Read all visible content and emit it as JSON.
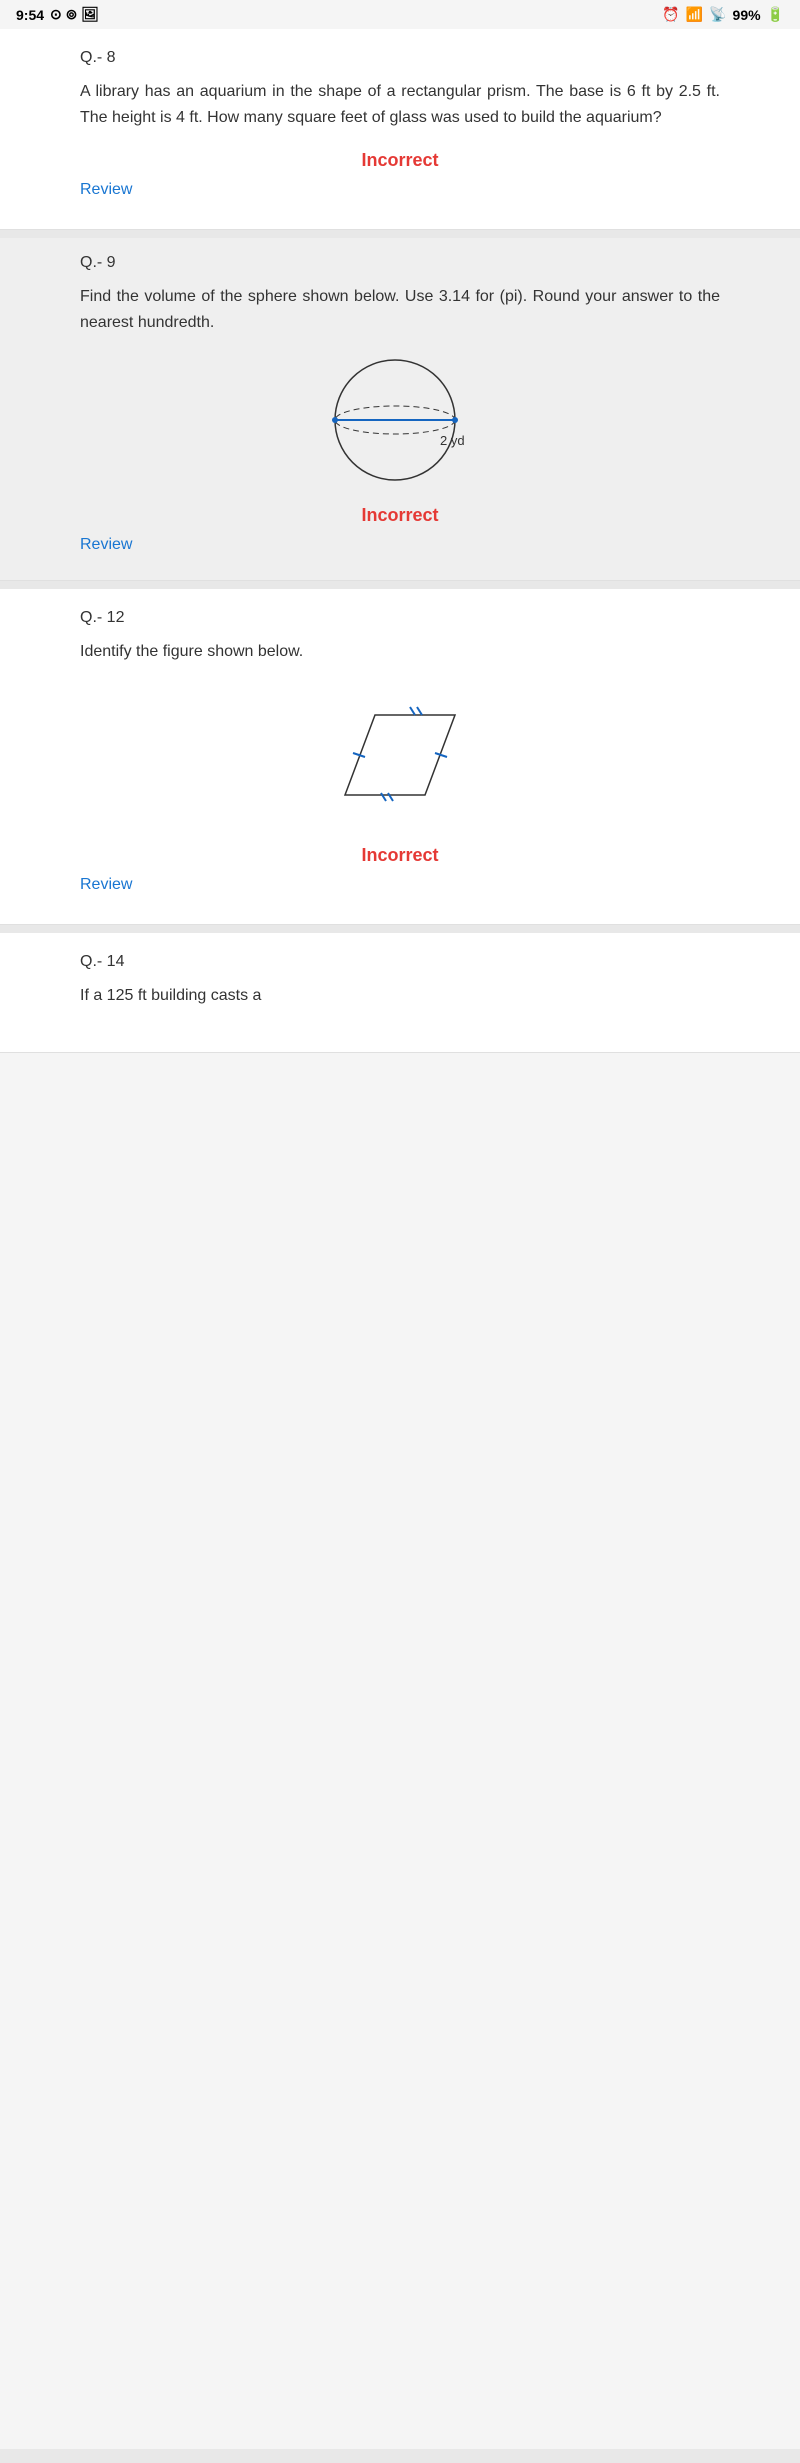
{
  "statusBar": {
    "time": "9:54",
    "battery": "99%"
  },
  "questions": [
    {
      "id": "q8",
      "number": "Q.- 8",
      "text": "A library has an aquarium in the shape of a rectangular prism. The base is 6 ft by 2.5 ft. The height is 4 ft. How many square feet of glass was used to build the aquarium?",
      "result": "Incorrect",
      "review": "Review"
    },
    {
      "id": "q9",
      "number": "Q.- 9",
      "text": "Find the volume of the sphere shown below. Use 3.14 for (pi). Round your answer to the nearest hundredth.",
      "diagramLabel": "2 yd",
      "result": "Incorrect",
      "review": "Review"
    },
    {
      "id": "q12",
      "number": "Q.- 12",
      "text": "Identify the figure shown below.",
      "result": "Incorrect",
      "review": "Review"
    },
    {
      "id": "q14",
      "number": "Q.- 14",
      "text": "If a 125 ft building casts a"
    }
  ]
}
